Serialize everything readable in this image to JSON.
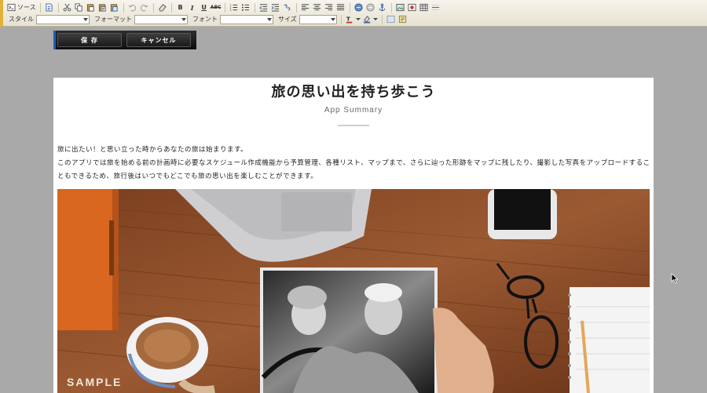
{
  "toolbar": {
    "source_label": "ソース",
    "style_label": "スタイル",
    "format_label": "フォーマット",
    "font_label": "フォント",
    "size_label": "サイズ",
    "style_value": "",
    "format_value": "",
    "font_value": "",
    "size_value": ""
  },
  "actions": {
    "save_label": "保 存",
    "cancel_label": "キャンセル"
  },
  "article": {
    "title": "旅の思い出を持ち歩こう",
    "subtitle": "App Summary",
    "paragraph_1": "旅に出たい！と思い立った時からあなたの旅は始まります。",
    "paragraph_2": "このアプリでは旅を始める前の計画時に必要なスケジュール作成機能から予算管理、各種リスト、マップまで、さらに辿った形跡をマップに残したり、撮影した写真をアップロードすることもできるため、旅行後はいつでもどこでも旅の思い出を楽しむことができます。",
    "image_watermark": "SAMPLE"
  },
  "colors": {
    "toolbar_bg": "#ece8da",
    "action_bar_bg": "#1a1a1a",
    "accent_blue": "#1e5bb8",
    "page_bg": "#a9a9a9",
    "wood": "#8a4a24"
  }
}
